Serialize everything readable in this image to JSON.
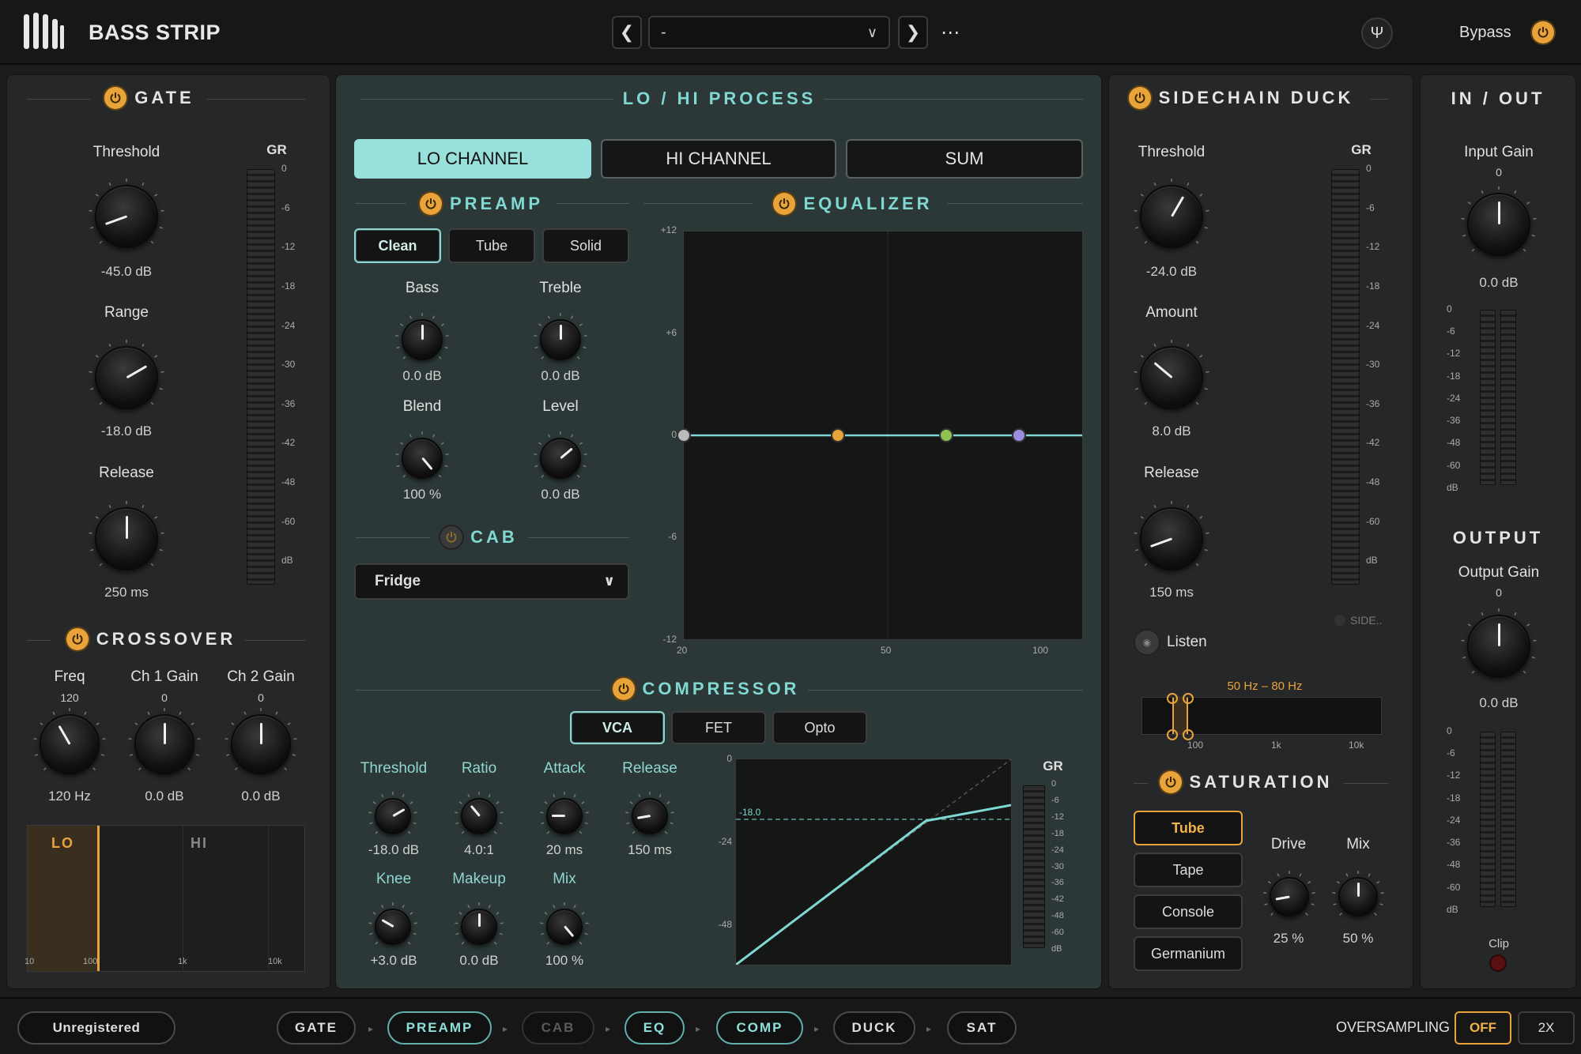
{
  "app": {
    "title": "BASS STRIP",
    "preset": "-",
    "bypass_label": "Bypass"
  },
  "gate": {
    "title": "GATE",
    "threshold": {
      "label": "Threshold",
      "value": "-45.0 dB"
    },
    "range": {
      "label": "Range",
      "value": "-18.0 dB"
    },
    "release": {
      "label": "Release",
      "value": "250 ms"
    },
    "gr_label": "GR",
    "gr_scale": [
      "0",
      "-6",
      "-12",
      "-18",
      "-24",
      "-30",
      "-36",
      "-42",
      "-48",
      "-60",
      "dB"
    ]
  },
  "crossover": {
    "title": "CROSSOVER",
    "freq": {
      "label": "Freq",
      "top": "120",
      "value": "120 Hz"
    },
    "ch1": {
      "label": "Ch 1 Gain",
      "top": "0",
      "value": "0.0 dB"
    },
    "ch2": {
      "label": "Ch 2 Gain",
      "top": "0",
      "value": "0.0 dB"
    },
    "lo": "LO",
    "hi": "HI",
    "axis": [
      "10",
      "100",
      "1k",
      "10k"
    ]
  },
  "process": {
    "title": "LO / HI PROCESS",
    "tabs": [
      "LO CHANNEL",
      "HI CHANNEL",
      "SUM"
    ]
  },
  "preamp": {
    "title": "PREAMP",
    "modes": [
      "Clean",
      "Tube",
      "Solid"
    ],
    "bass": {
      "label": "Bass",
      "value": "0.0 dB"
    },
    "treble": {
      "label": "Treble",
      "value": "0.0 dB"
    },
    "blend": {
      "label": "Blend",
      "value": "100 %"
    },
    "level": {
      "label": "Level",
      "value": "0.0 dB"
    }
  },
  "cab": {
    "title": "CAB",
    "selected": "Fridge"
  },
  "eq": {
    "title": "EQUALIZER",
    "y_ticks": [
      "+12",
      "+6",
      "0",
      "-6",
      "-12"
    ],
    "x_ticks": [
      "20",
      "50",
      "100"
    ],
    "colors": {
      "line": "#7fd8d2",
      "band1": "#e8a43a",
      "band2": "#8fc255",
      "band3": "#9a8ee0"
    }
  },
  "compressor": {
    "title": "COMPRESSOR",
    "modes": [
      "VCA",
      "FET",
      "Opto"
    ],
    "threshold": {
      "label": "Threshold",
      "value": "-18.0 dB"
    },
    "ratio": {
      "label": "Ratio",
      "value": "4.0:1"
    },
    "attack": {
      "label": "Attack",
      "value": "20 ms"
    },
    "release": {
      "label": "Release",
      "value": "150 ms"
    },
    "knee": {
      "label": "Knee",
      "value": "+3.0 dB"
    },
    "makeup": {
      "label": "Makeup",
      "value": "0.0 dB"
    },
    "mix": {
      "label": "Mix",
      "value": "100 %"
    },
    "graph_y": [
      "0",
      "-24",
      "-48"
    ],
    "threshold_marker": "-18.0",
    "gr_label": "GR",
    "gr_scale": [
      "0",
      "-6",
      "-12",
      "-18",
      "-24",
      "-30",
      "-36",
      "-42",
      "-48",
      "-60",
      "dB"
    ]
  },
  "duck": {
    "title": "SIDECHAIN DUCK",
    "threshold": {
      "label": "Threshold",
      "value": "-24.0 dB"
    },
    "amount": {
      "label": "Amount",
      "value": "8.0 dB"
    },
    "release": {
      "label": "Release",
      "value": "150 ms"
    },
    "gr_label": "GR",
    "gr_scale": [
      "0",
      "-6",
      "-12",
      "-18",
      "-24",
      "-30",
      "-36",
      "-42",
      "-48",
      "-60",
      "dB"
    ],
    "side_label": "SIDE..",
    "listen": "Listen",
    "band_label": "50 Hz – 80 Hz",
    "band_axis": [
      "100",
      "1k",
      "10k"
    ]
  },
  "saturation": {
    "title": "SATURATION",
    "types": [
      "Tube",
      "Tape",
      "Console",
      "Germanium"
    ],
    "drive": {
      "label": "Drive",
      "value": "25 %"
    },
    "mix": {
      "label": "Mix",
      "value": "50 %"
    }
  },
  "io": {
    "title": "IN / OUT",
    "input": {
      "label": "Input Gain",
      "top": "0",
      "value": "0.0 dB"
    },
    "output_title": "OUTPUT",
    "output": {
      "label": "Output Gain",
      "top": "0",
      "value": "0.0 dB"
    },
    "scale": [
      "0",
      "-6",
      "-12",
      "-18",
      "-24",
      "-36",
      "-48",
      "-60",
      "dB"
    ],
    "clip": "Clip"
  },
  "footer": {
    "registration": "Unregistered",
    "chain": [
      "GATE",
      "PREAMP",
      "CAB",
      "EQ",
      "COMP",
      "DUCK",
      "SAT"
    ],
    "oversampling_label": "OVERSAMPLING",
    "os_off": "OFF",
    "os_2x": "2X"
  }
}
